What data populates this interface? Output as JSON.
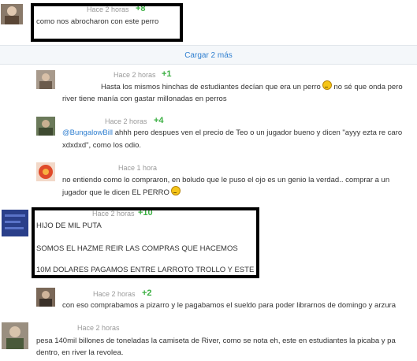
{
  "load_more": {
    "label": "Cargar 2 más"
  },
  "comments": [
    {
      "time": "Hace 2 horas",
      "votes": "+8",
      "lines": [
        "como nos abrocharon con este perro"
      ]
    },
    {
      "time": "Hace 2 horas",
      "votes": "+1",
      "lines": [
        "Hasta los mismos hinchas de estudiantes decían que era un perro",
        "no sé que onda pero",
        "river tiene manía con gastar millonadas en perros"
      ]
    },
    {
      "time": "Hace 2 horas",
      "votes": "+4",
      "mention": "@BungalowBill",
      "lines": [
        "ahhh pero despues ven el precio de Teo o un jugador bueno y dicen \"ayyy ezta re caro",
        "xdxdxd\", como los odio."
      ]
    },
    {
      "time": "Hace 1 hora",
      "votes": "",
      "lines": [
        "no entiendo como lo compraron, en boludo que le puso el ojo es un genio la verdad.. comprar a un",
        "jugador que le dicen EL PERRO"
      ]
    },
    {
      "time": "Hace 2 horas",
      "votes": "+10",
      "lines": [
        "HIJO DE MIL PUTA",
        "SOMOS EL HAZME REIR LAS COMPRAS QUE HACEMOS",
        "10M DOLARES PAGAMOS ENTRE LARROTO TROLLO Y ESTE"
      ]
    },
    {
      "time": "Hace 2 horas",
      "votes": "+2",
      "lines": [
        "con eso comprabamos a pizarro y le pagabamos el sueldo para poder librarnos de domingo y arzura"
      ]
    },
    {
      "time": "Hace 2 horas",
      "votes": "",
      "lines": [
        "pesa 140mil billones de toneladas la camiseta de River, como se nota eh, este en estudiantes la picaba y pa",
        "dentro, en river la revolea."
      ]
    }
  ],
  "icons": {
    "emoji": "sad-face-emoji-icon"
  }
}
